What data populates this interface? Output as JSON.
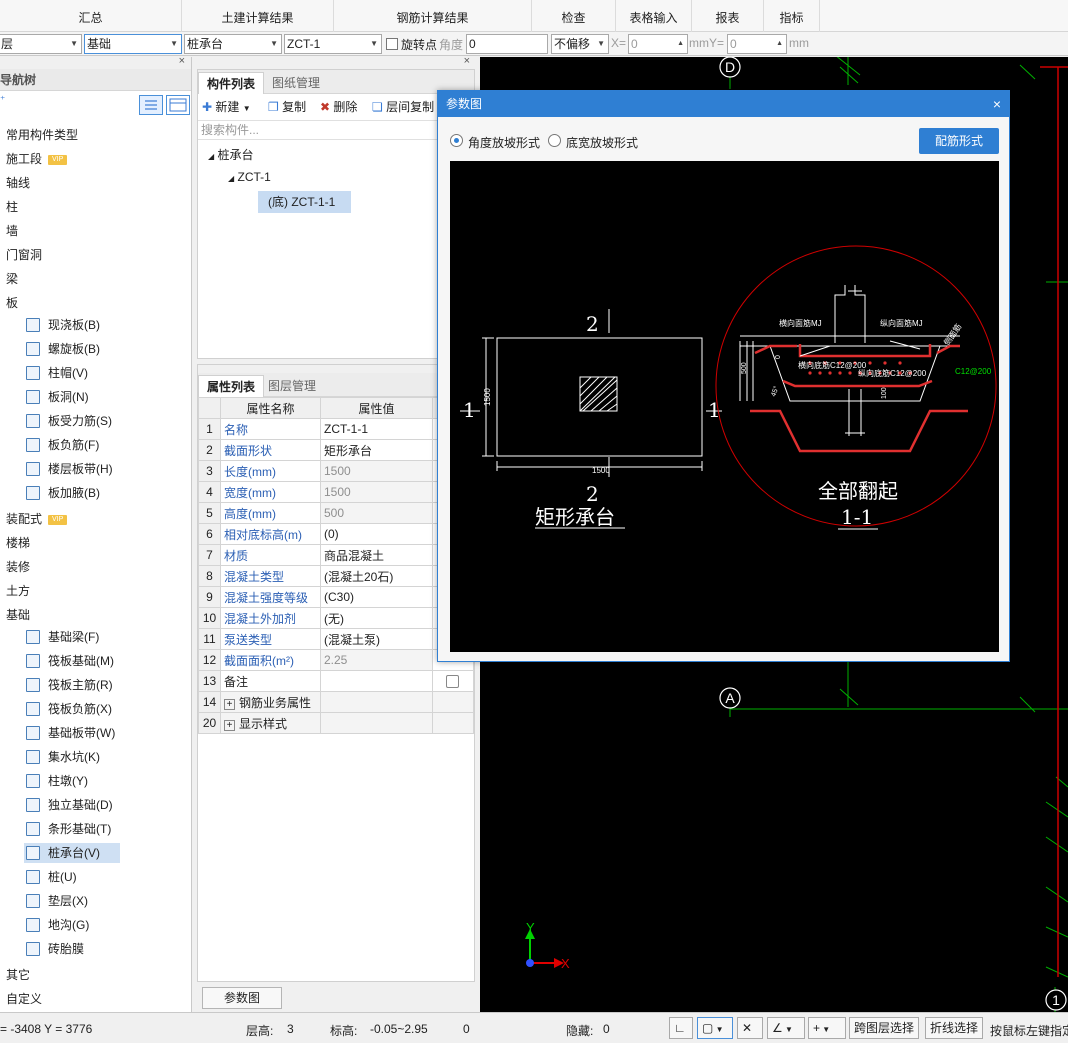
{
  "menu": {
    "items": [
      "汇总",
      "土建计算结果",
      "钢筋计算结果",
      "检查",
      "表格输入",
      "报表",
      "指标"
    ]
  },
  "toolbar": {
    "floor": "层",
    "category": "基础",
    "type": "桩承台",
    "component": "ZCT-1",
    "rotate_label": "旋转点",
    "angle_label": "角度",
    "angle_value": "0",
    "offset_select": "不偏移",
    "x_label": "X=",
    "x_value": "0",
    "mm_y_label": "mmY=",
    "y_value": "0",
    "mm_label": "mm"
  },
  "nav": {
    "title": "导航树",
    "items": [
      {
        "label": "常用构件类型"
      },
      {
        "label": "施工段",
        "badge": "VIP"
      },
      {
        "label": "轴线"
      },
      {
        "label": "柱"
      },
      {
        "label": "墙"
      },
      {
        "label": "门窗洞"
      },
      {
        "label": "梁"
      },
      {
        "label": "板"
      }
    ],
    "board_children": [
      "现浇板(B)",
      "螺旋板(B)",
      "柱帽(V)",
      "板洞(N)",
      "板受力筋(S)",
      "板负筋(F)",
      "楼层板带(H)",
      "板加腋(B)"
    ],
    "items2": [
      {
        "label": "装配式",
        "badge": "VIP"
      },
      {
        "label": "楼梯"
      },
      {
        "label": "装修"
      },
      {
        "label": "土方"
      },
      {
        "label": "基础"
      }
    ],
    "foundation_children": [
      "基础梁(F)",
      "筏板基础(M)",
      "筏板主筋(R)",
      "筏板负筋(X)",
      "基础板带(W)",
      "集水坑(K)",
      "柱墩(Y)",
      "独立基础(D)",
      "条形基础(T)",
      "桩承台(V)",
      "桩(U)",
      "垫层(X)",
      "地沟(G)",
      "砖胎膜"
    ],
    "items3": [
      "其它",
      "自定义"
    ]
  },
  "components": {
    "tab_list": "构件列表",
    "tab_drawing": "图纸管理",
    "new_label": "新建",
    "copy_label": "复制",
    "delete_label": "删除",
    "floor_copy_label": "层间复制",
    "search_placeholder": "搜索构件...",
    "tree_root": "桩承台",
    "tree_child": "ZCT-1",
    "tree_leaf": "(底) ZCT-1-1"
  },
  "properties": {
    "tab_props": "属性列表",
    "tab_layers": "图层管理",
    "col_name": "属性名称",
    "col_value": "属性值",
    "rows": [
      {
        "no": "1",
        "name": "名称",
        "value": "ZCT-1-1"
      },
      {
        "no": "2",
        "name": "截面形状",
        "value": "矩形承台"
      },
      {
        "no": "3",
        "name": "长度(mm)",
        "value": "1500"
      },
      {
        "no": "4",
        "name": "宽度(mm)",
        "value": "1500"
      },
      {
        "no": "5",
        "name": "高度(mm)",
        "value": "500"
      },
      {
        "no": "6",
        "name": "相对底标高(m)",
        "value": "(0)"
      },
      {
        "no": "7",
        "name": "材质",
        "value": "商品混凝土"
      },
      {
        "no": "8",
        "name": "混凝土类型",
        "value": "(混凝土20石)"
      },
      {
        "no": "9",
        "name": "混凝土强度等级",
        "value": "(C30)"
      },
      {
        "no": "10",
        "name": "混凝土外加剂",
        "value": "(无)"
      },
      {
        "no": "11",
        "name": "泵送类型",
        "value": "(混凝土泵)"
      },
      {
        "no": "12",
        "name": "截面面积(m²)",
        "value": "2.25"
      },
      {
        "no": "13",
        "name": "备注",
        "value": ""
      },
      {
        "no": "14",
        "name": "钢筋业务属性",
        "value": ""
      },
      {
        "no": "20",
        "name": "显示样式",
        "value": ""
      }
    ],
    "param_button": "参数图"
  },
  "dialog": {
    "title": "参数图",
    "radio1": "角度放坡形式",
    "radio2": "底宽放坡形式",
    "rebar_button": "配筋形式",
    "plan_caption": "矩形承台",
    "section_caption": "全部翻起",
    "section_label": "1-1",
    "dim_1500": "1500",
    "dim_500": "500",
    "mark_1": "1",
    "mark_2": "2",
    "lbl_hmj": "横向面筋MJ",
    "lbl_zmj": "纵向面筋MJ",
    "lbl_hdj": "横向底筋C12@200",
    "lbl_zdj": "纵向底筋C12@200",
    "lbl_c12": "C12@200",
    "lbl_side": "侧面筋",
    "lbl_45": "45°",
    "lbl_d": "100",
    "lbl_zero": "0"
  },
  "canvas": {
    "axis_d": "D",
    "axis_a": "A",
    "axis_1": "1",
    "x_label": "X",
    "y_label": "Y"
  },
  "status": {
    "coords": "= -3408 Y = 3776",
    "floor_height_label": "层高:",
    "floor_height": "3",
    "elevation_label": "标高:",
    "elevation": "-0.05~2.95",
    "zero": "0",
    "hidden_label": "隐藏:",
    "hidden": "0",
    "cross_floor_btn": "跨图层选择",
    "polyline_btn": "折线选择",
    "hint": "按鼠标左键指定"
  }
}
